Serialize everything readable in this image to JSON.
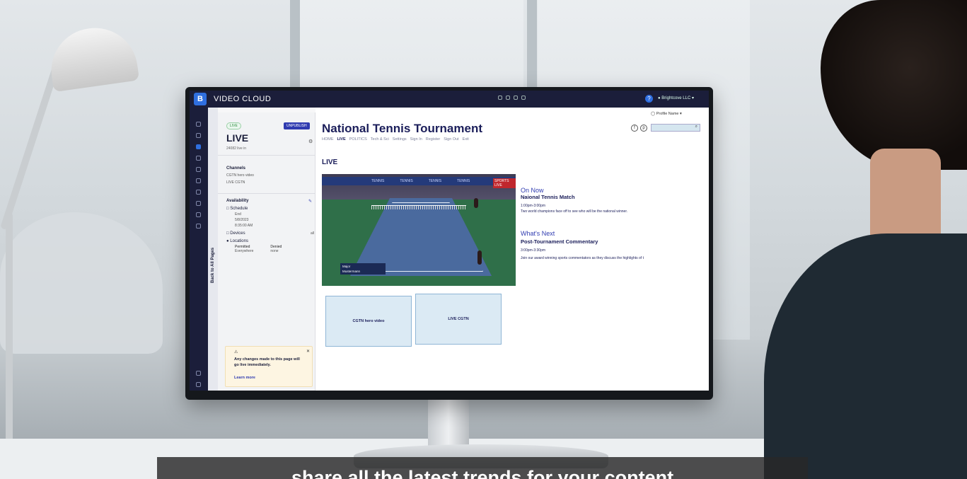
{
  "app": {
    "title": "VIDEO CLOUD",
    "logo_letter": "B",
    "account": "Brightcove LLC"
  },
  "rail": {
    "back_label": "Back to All Pages"
  },
  "panel": {
    "status_pill": "LIVE",
    "unpublish_label": "UNPUBLISH",
    "title": "LIVE",
    "subtitle": "24082 live in",
    "channels_heading": "Channels",
    "channels": [
      "CGTN hero video",
      "LIVE CGTN"
    ],
    "availability_heading": "Availability",
    "schedule_label": "Schedule",
    "end_label": "End",
    "end_date": "5/8/2023",
    "end_time": "8:35:00 AM",
    "devices_label": "Devices",
    "devices_value": "all",
    "locations_label": "Locations",
    "permitted_label": "Permitted",
    "permitted_value": "Everywhere",
    "denied_label": "Denied",
    "denied_value": "none",
    "warning_text": "Any changes made to this page will go live immediately.",
    "learn_more": "Learn more"
  },
  "site": {
    "title": "National Tennis Tournament",
    "profile_label": "Profile Name",
    "nav": [
      "HOME",
      "LIVE",
      "POLITICS",
      "Tech & Sci",
      "Settings",
      "Sign In",
      "Register",
      "Sign Out",
      "Exit"
    ],
    "section_heading": "LIVE",
    "video": {
      "banner_words": [
        "TENNIS",
        "TENNIS",
        "TENNIS",
        "TENNIS"
      ],
      "sports_live": "SPORTS LIVE",
      "score_rows": [
        "Major",
        "Mustermann"
      ]
    },
    "on_now": {
      "heading": "On Now",
      "title": "Naional Tennis Match",
      "time": "1:00pm-3:00pm",
      "description": "Two world champions face off to see who will be the national winner."
    },
    "whats_next": {
      "heading": "What's Next",
      "title": "Post-Tournament Commentary",
      "time": "3:00pm-3:30pm",
      "description": "Join our award winning sports commentators as they discuss the highlights of t"
    },
    "tiles": [
      "CGTN hero video",
      "LIVE CGTN"
    ]
  },
  "caption": {
    "text": "share all the latest trends for your content"
  }
}
